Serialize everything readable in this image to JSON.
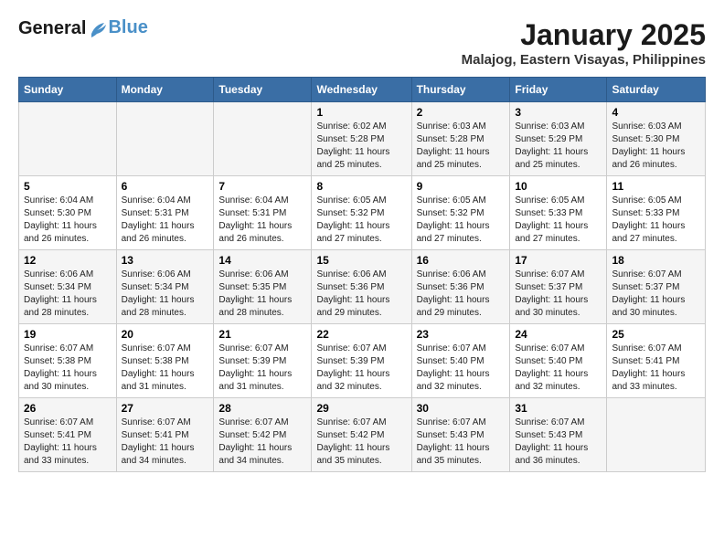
{
  "logo": {
    "line1": "General",
    "line2": "Blue"
  },
  "title": "January 2025",
  "subtitle": "Malajog, Eastern Visayas, Philippines",
  "header_days": [
    "Sunday",
    "Monday",
    "Tuesday",
    "Wednesday",
    "Thursday",
    "Friday",
    "Saturday"
  ],
  "weeks": [
    [
      {
        "day": "",
        "content": ""
      },
      {
        "day": "",
        "content": ""
      },
      {
        "day": "",
        "content": ""
      },
      {
        "day": "1",
        "content": "Sunrise: 6:02 AM\nSunset: 5:28 PM\nDaylight: 11 hours and 25 minutes."
      },
      {
        "day": "2",
        "content": "Sunrise: 6:03 AM\nSunset: 5:28 PM\nDaylight: 11 hours and 25 minutes."
      },
      {
        "day": "3",
        "content": "Sunrise: 6:03 AM\nSunset: 5:29 PM\nDaylight: 11 hours and 25 minutes."
      },
      {
        "day": "4",
        "content": "Sunrise: 6:03 AM\nSunset: 5:30 PM\nDaylight: 11 hours and 26 minutes."
      }
    ],
    [
      {
        "day": "5",
        "content": "Sunrise: 6:04 AM\nSunset: 5:30 PM\nDaylight: 11 hours and 26 minutes."
      },
      {
        "day": "6",
        "content": "Sunrise: 6:04 AM\nSunset: 5:31 PM\nDaylight: 11 hours and 26 minutes."
      },
      {
        "day": "7",
        "content": "Sunrise: 6:04 AM\nSunset: 5:31 PM\nDaylight: 11 hours and 26 minutes."
      },
      {
        "day": "8",
        "content": "Sunrise: 6:05 AM\nSunset: 5:32 PM\nDaylight: 11 hours and 27 minutes."
      },
      {
        "day": "9",
        "content": "Sunrise: 6:05 AM\nSunset: 5:32 PM\nDaylight: 11 hours and 27 minutes."
      },
      {
        "day": "10",
        "content": "Sunrise: 6:05 AM\nSunset: 5:33 PM\nDaylight: 11 hours and 27 minutes."
      },
      {
        "day": "11",
        "content": "Sunrise: 6:05 AM\nSunset: 5:33 PM\nDaylight: 11 hours and 27 minutes."
      }
    ],
    [
      {
        "day": "12",
        "content": "Sunrise: 6:06 AM\nSunset: 5:34 PM\nDaylight: 11 hours and 28 minutes."
      },
      {
        "day": "13",
        "content": "Sunrise: 6:06 AM\nSunset: 5:34 PM\nDaylight: 11 hours and 28 minutes."
      },
      {
        "day": "14",
        "content": "Sunrise: 6:06 AM\nSunset: 5:35 PM\nDaylight: 11 hours and 28 minutes."
      },
      {
        "day": "15",
        "content": "Sunrise: 6:06 AM\nSunset: 5:36 PM\nDaylight: 11 hours and 29 minutes."
      },
      {
        "day": "16",
        "content": "Sunrise: 6:06 AM\nSunset: 5:36 PM\nDaylight: 11 hours and 29 minutes."
      },
      {
        "day": "17",
        "content": "Sunrise: 6:07 AM\nSunset: 5:37 PM\nDaylight: 11 hours and 30 minutes."
      },
      {
        "day": "18",
        "content": "Sunrise: 6:07 AM\nSunset: 5:37 PM\nDaylight: 11 hours and 30 minutes."
      }
    ],
    [
      {
        "day": "19",
        "content": "Sunrise: 6:07 AM\nSunset: 5:38 PM\nDaylight: 11 hours and 30 minutes."
      },
      {
        "day": "20",
        "content": "Sunrise: 6:07 AM\nSunset: 5:38 PM\nDaylight: 11 hours and 31 minutes."
      },
      {
        "day": "21",
        "content": "Sunrise: 6:07 AM\nSunset: 5:39 PM\nDaylight: 11 hours and 31 minutes."
      },
      {
        "day": "22",
        "content": "Sunrise: 6:07 AM\nSunset: 5:39 PM\nDaylight: 11 hours and 32 minutes."
      },
      {
        "day": "23",
        "content": "Sunrise: 6:07 AM\nSunset: 5:40 PM\nDaylight: 11 hours and 32 minutes."
      },
      {
        "day": "24",
        "content": "Sunrise: 6:07 AM\nSunset: 5:40 PM\nDaylight: 11 hours and 32 minutes."
      },
      {
        "day": "25",
        "content": "Sunrise: 6:07 AM\nSunset: 5:41 PM\nDaylight: 11 hours and 33 minutes."
      }
    ],
    [
      {
        "day": "26",
        "content": "Sunrise: 6:07 AM\nSunset: 5:41 PM\nDaylight: 11 hours and 33 minutes."
      },
      {
        "day": "27",
        "content": "Sunrise: 6:07 AM\nSunset: 5:41 PM\nDaylight: 11 hours and 34 minutes."
      },
      {
        "day": "28",
        "content": "Sunrise: 6:07 AM\nSunset: 5:42 PM\nDaylight: 11 hours and 34 minutes."
      },
      {
        "day": "29",
        "content": "Sunrise: 6:07 AM\nSunset: 5:42 PM\nDaylight: 11 hours and 35 minutes."
      },
      {
        "day": "30",
        "content": "Sunrise: 6:07 AM\nSunset: 5:43 PM\nDaylight: 11 hours and 35 minutes."
      },
      {
        "day": "31",
        "content": "Sunrise: 6:07 AM\nSunset: 5:43 PM\nDaylight: 11 hours and 36 minutes."
      },
      {
        "day": "",
        "content": ""
      }
    ]
  ]
}
